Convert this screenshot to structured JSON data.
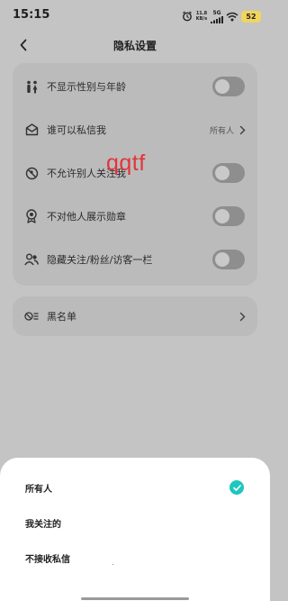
{
  "status_bar": {
    "time": "15:15",
    "net_speed_value": "11.8",
    "net_speed_unit": "KB/s",
    "network": "5G",
    "battery": "52"
  },
  "header": {
    "title": "隐私设置"
  },
  "settings": [
    {
      "label": "不显示性别与年龄",
      "toggle": "off",
      "icon": "gender-icon"
    },
    {
      "label": "谁可以私信我",
      "value": "所有人",
      "icon": "message-icon"
    },
    {
      "label": "不允许别人关注我",
      "toggle": "off",
      "icon": "no-follow-icon"
    },
    {
      "label": "不对他人展示勋章",
      "toggle": "off",
      "icon": "medal-icon"
    },
    {
      "label": "隐藏关注/粉丝/访客一栏",
      "toggle": "off",
      "icon": "users-icon"
    }
  ],
  "blocklist": {
    "label": "黑名单",
    "icon": "blocklist-icon"
  },
  "watermark": "qqtf",
  "sheet": {
    "options": [
      {
        "label": "所有人",
        "selected": true
      },
      {
        "label": "我关注的",
        "selected": false
      },
      {
        "label": "不接收私信",
        "selected": false
      }
    ]
  },
  "colors": {
    "accent": "#1ec7bd",
    "watermark": "#e3343b",
    "battery": "#f1d55d"
  }
}
